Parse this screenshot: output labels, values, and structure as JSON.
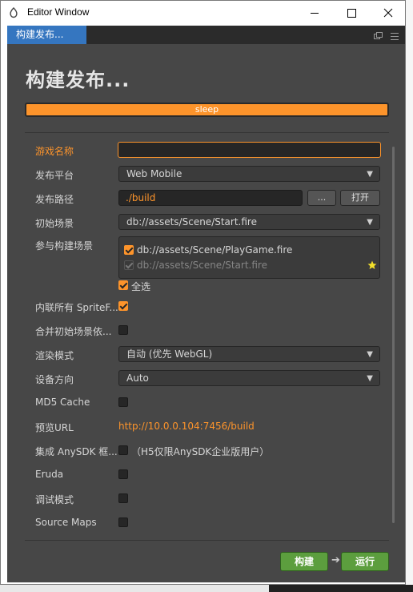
{
  "window": {
    "title": "Editor Window"
  },
  "tab": {
    "label": "构建发布..."
  },
  "heading": "构建发布...",
  "progress": {
    "label": "sleep",
    "value": 1.0
  },
  "form": {
    "game_name": {
      "label": "游戏名称",
      "value": ""
    },
    "platform": {
      "label": "发布平台",
      "value": "Web Mobile"
    },
    "build_path": {
      "label": "发布路径",
      "value": "./build",
      "dots_label": "...",
      "open_label": "打开"
    },
    "start_scene": {
      "label": "初始场景",
      "value": "db://assets/Scene/Start.fire"
    },
    "build_scenes": {
      "label": "参与构建场景",
      "items": [
        {
          "path": "db://assets/Scene/PlayGame.fire"
        },
        {
          "path": "db://assets/Scene/Start.fire"
        }
      ],
      "select_all_label": "全选"
    },
    "inline_sprite": {
      "label": "内联所有 SpriteF..."
    },
    "merge_scene": {
      "label": "合并初始场景依..."
    },
    "render_mode": {
      "label": "渲染模式",
      "value": "自动 (优先 WebGL)"
    },
    "orientation": {
      "label": "设备方向",
      "value": "Auto"
    },
    "md5": {
      "label": "MD5 Cache"
    },
    "preview_url": {
      "label": "预览URL",
      "value": "http://10.0.0.104:7456/build"
    },
    "anysdk": {
      "label": "集成 AnySDK 框...",
      "note": "（H5仅限AnySDK企业版用户）"
    },
    "eruda": {
      "label": "Eruda"
    },
    "debug": {
      "label": "调试模式"
    },
    "source_maps": {
      "label": "Source Maps"
    }
  },
  "buttons": {
    "build": "构建",
    "run": "运行"
  },
  "colors": {
    "accent": "#fd942b",
    "panel": "#474747",
    "tab": "#3576c0",
    "green": "#5c9e3e"
  }
}
